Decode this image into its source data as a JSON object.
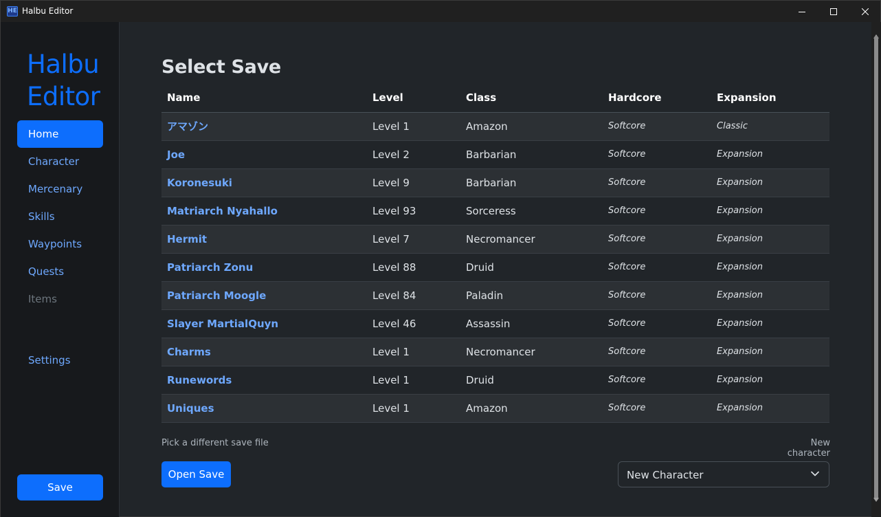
{
  "window": {
    "icon_text": "HE",
    "title": "Halbu Editor"
  },
  "sidebar": {
    "brand_line1": "Halbu",
    "brand_line2": "Editor",
    "items": [
      {
        "label": "Home"
      },
      {
        "label": "Character"
      },
      {
        "label": "Mercenary"
      },
      {
        "label": "Skills"
      },
      {
        "label": "Waypoints"
      },
      {
        "label": "Quests"
      },
      {
        "label": "Items"
      }
    ],
    "settings_label": "Settings",
    "save_label": "Save"
  },
  "main": {
    "title": "Select Save",
    "columns": [
      "Name",
      "Level",
      "Class",
      "Hardcore",
      "Expansion"
    ],
    "rows": [
      {
        "name": "アマゾン",
        "level": "Level 1",
        "class": "Amazon",
        "hardcore": "Softcore",
        "expansion": "Classic"
      },
      {
        "name": "Joe",
        "level": "Level 2",
        "class": "Barbarian",
        "hardcore": "Softcore",
        "expansion": "Expansion"
      },
      {
        "name": "Koronesuki",
        "level": "Level 9",
        "class": "Barbarian",
        "hardcore": "Softcore",
        "expansion": "Expansion"
      },
      {
        "name": "Matriarch Nyahallo",
        "level": "Level 93",
        "class": "Sorceress",
        "hardcore": "Softcore",
        "expansion": "Expansion"
      },
      {
        "name": "Hermit",
        "level": "Level 7",
        "class": "Necromancer",
        "hardcore": "Softcore",
        "expansion": "Expansion"
      },
      {
        "name": "Patriarch Zonu",
        "level": "Level 88",
        "class": "Druid",
        "hardcore": "Softcore",
        "expansion": "Expansion"
      },
      {
        "name": "Patriarch Moogle",
        "level": "Level 84",
        "class": "Paladin",
        "hardcore": "Softcore",
        "expansion": "Expansion"
      },
      {
        "name": "Slayer MartialQuyn",
        "level": "Level 46",
        "class": "Assassin",
        "hardcore": "Softcore",
        "expansion": "Expansion"
      },
      {
        "name": "Charms",
        "level": "Level 1",
        "class": "Necromancer",
        "hardcore": "Softcore",
        "expansion": "Expansion"
      },
      {
        "name": "Runewords",
        "level": "Level 1",
        "class": "Druid",
        "hardcore": "Softcore",
        "expansion": "Expansion"
      },
      {
        "name": "Uniques",
        "level": "Level 1",
        "class": "Amazon",
        "hardcore": "Softcore",
        "expansion": "Expansion"
      }
    ],
    "hint_left": "Pick a different save file",
    "hint_right": "New character",
    "open_label": "Open Save",
    "new_character_select": "New Character"
  },
  "colors": {
    "accent": "#0d6efd",
    "link": "#6ea8fe",
    "background": "#212529",
    "sidebar": "#17191c"
  }
}
